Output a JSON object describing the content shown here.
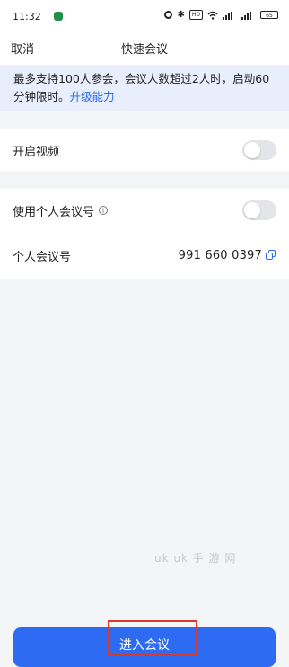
{
  "status_bar": {
    "time": "11:32",
    "battery": "65"
  },
  "nav": {
    "cancel": "取消",
    "title": "快速会议"
  },
  "notice": {
    "text": "最多支持100人参会，会议人数超过2人时，启动60分钟限时。",
    "link": "升级能力"
  },
  "settings": {
    "enable_video": {
      "label": "开启视频",
      "on": false
    },
    "use_personal_id": {
      "label": "使用个人会议号",
      "on": false
    },
    "personal_id": {
      "label": "个人会议号",
      "value": "991 660 0397"
    }
  },
  "watermark": "uk uk 手 游 网",
  "enter_button": "进入会议",
  "colors": {
    "accent": "#2c6bf2",
    "notice_bg": "#e9eefc",
    "highlight": "#d73a2a"
  }
}
